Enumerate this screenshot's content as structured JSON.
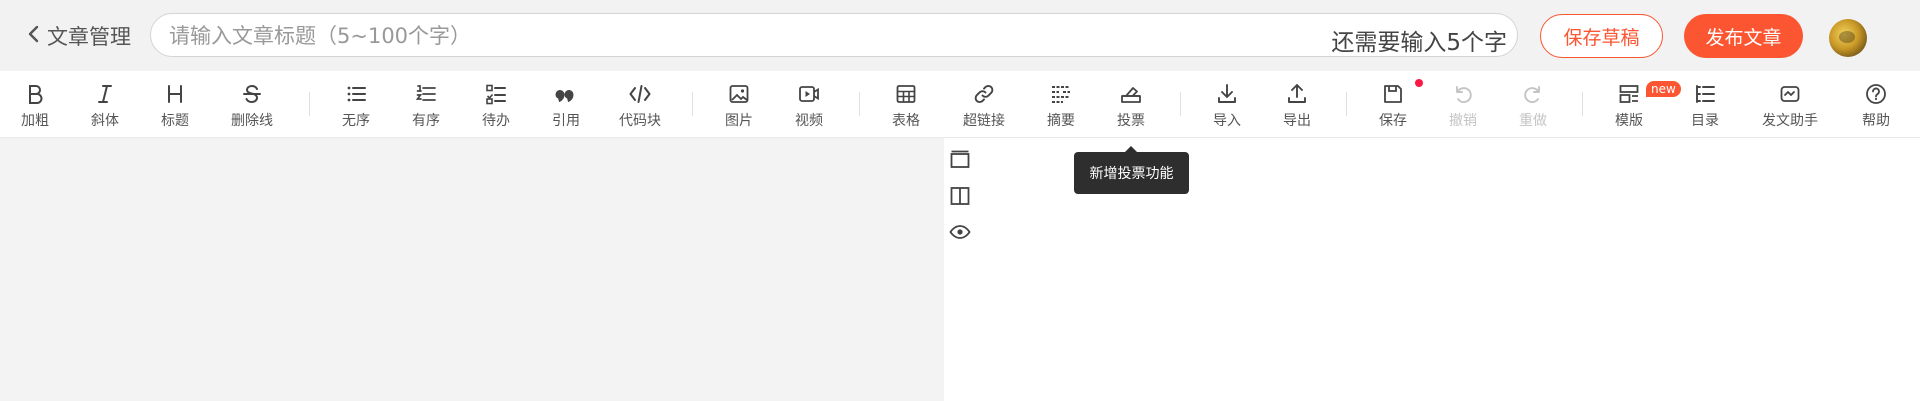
{
  "header": {
    "back_label": "文章管理",
    "title_placeholder": "请输入文章标题（5~100个字）",
    "title_value": "",
    "counter_text": "还需要输入5个字",
    "save_draft_label": "保存草稿",
    "publish_label": "发布文章"
  },
  "toolbar": {
    "bold": "加粗",
    "italic": "斜体",
    "heading": "标题",
    "strike": "删除线",
    "unordered": "无序",
    "ordered": "有序",
    "todo": "待办",
    "quote": "引用",
    "code": "代码块",
    "image": "图片",
    "video": "视频",
    "table": "表格",
    "link": "超链接",
    "summary": "摘要",
    "vote": "投票",
    "import": "导入",
    "export": "导出",
    "save": "保存",
    "undo": "撤销",
    "redo": "重做",
    "template": "模版",
    "template_badge": "new",
    "toc": "目录",
    "assistant": "发文助手",
    "help": "帮助"
  },
  "tooltip": {
    "text": "新增投票功能"
  },
  "colors": {
    "accent": "#fc5531",
    "dot": "#fc1944",
    "disabled": "#c4c4c4",
    "tooltip_bg": "#2e2e2e"
  }
}
